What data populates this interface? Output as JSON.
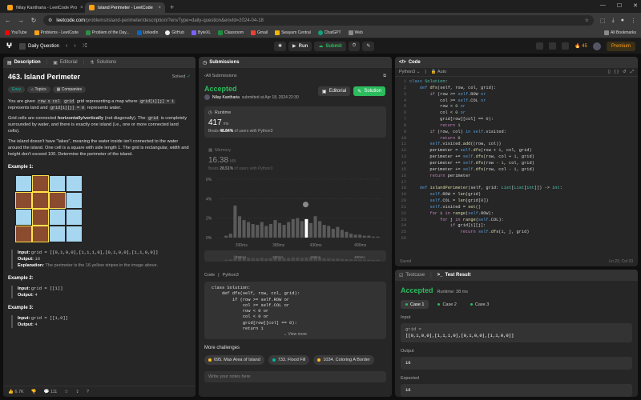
{
  "browser": {
    "tabs": [
      {
        "title": "Nilay Kantharia - LeetCode Pro",
        "active": false
      },
      {
        "title": "Island Perimeter - LeetCode",
        "active": true
      }
    ],
    "url_host": "leetcode.com",
    "url_path": "/problems/island-perimeter/description/?envType=daily-question&envId=2024-04-18",
    "bookmarks": [
      "YouTube",
      "Problems - LeetCode",
      "Problem of the Day...",
      "LinkedIn",
      "GitHub",
      "ByteXL",
      "Classroom",
      "Gmail",
      "Swayam Central",
      "ChatGPT",
      "Web"
    ],
    "all_bookmarks": "All Bookmarks"
  },
  "header": {
    "daily": "Daily Question",
    "run": "Run",
    "submit": "Submit",
    "streak": "45",
    "premium": "Premium"
  },
  "desc": {
    "tabs": [
      "Description",
      "Editorial",
      "Solutions"
    ],
    "title": "463. Island Perimeter",
    "solved": "Solved",
    "tags": [
      "Easy",
      "Topics",
      "Companies"
    ],
    "p1_a": "You are given",
    "p1_code1": "row x col",
    "p1_b": "grid representing a map where",
    "p1_code2": "grid[i][j] = 1",
    "p1_c": "represents land and",
    "p1_code3": "grid[i][j] = 0",
    "p1_d": "represents water.",
    "p2_a": "Grid cells are connected",
    "p2_b": "horizontally/vertically",
    "p2_c": "(not diagonally). The",
    "p2_code": "grid",
    "p2_d": "is completely surrounded by water, and there is exactly one island (i.e., one or more connected land cells).",
    "p3": "The island doesn't have \"lakes\", meaning the water inside isn't connected to the water around the island. One cell is a square with side length 1. The grid is rectangular, width and height don't exceed 100. Determine the perimeter of the island.",
    "examples": [
      {
        "h": "Example 1:",
        "input": "grid = [[0,1,0,0],[1,1,1,0],[0,1,0,0],[1,1,0,0]]",
        "output": "16",
        "expl": "The perimeter is the 16 yellow stripes in the image above."
      },
      {
        "h": "Example 2:",
        "input": "grid = [[1]]",
        "output": "4"
      },
      {
        "h": "Example 3:",
        "input": "grid = [[1,0]]",
        "output": "4"
      }
    ],
    "lbl_input": "Input:",
    "lbl_output": "Output:",
    "lbl_expl": "Explanation:",
    "grid": [
      [
        0,
        1,
        0,
        0
      ],
      [
        1,
        1,
        1,
        0
      ],
      [
        0,
        1,
        0,
        0
      ],
      [
        1,
        1,
        0,
        0
      ]
    ],
    "likes": "6.7K",
    "comments": "111"
  },
  "subs": {
    "tab": "Submissions",
    "back": "All Submissions",
    "status": "Accepted",
    "user": "Nilay Kantharia",
    "submitted": "submitted at Apr 18, 2024 22:30",
    "editorial": "Editorial",
    "solution": "Solution",
    "runtime_label": "Runtime",
    "runtime_val": "417",
    "runtime_unit": "ms",
    "runtime_beats_a": "Beats",
    "runtime_beats_pct": "48.84%",
    "runtime_beats_b": "of users with Python3",
    "memory_label": "Memory",
    "memory_val": "16.38",
    "memory_unit": "MB",
    "memory_beats_a": "Beats",
    "memory_beats_pct": "28.51%",
    "memory_beats_b": "of users with Python3",
    "code_label": "Code",
    "code_lang": "Python3",
    "code": [
      "class Solution:",
      "    def dfs(self, row, col, grid):",
      "        if (row >= self.ROW or",
      "            col >= self.COL or",
      "            row < 0 or",
      "            col < 0 or",
      "            grid[row][col] == 0):",
      "            return 1"
    ],
    "view_more": "View more",
    "more_challenges": "More challenges",
    "challenges": [
      "695. Max Area of Island",
      "733. Flood Fill",
      "1034. Coloring A Border"
    ],
    "notes_placeholder": "Write your notes here"
  },
  "chart_data": {
    "type": "bar",
    "title": "",
    "ylabel": "",
    "xlabel": "",
    "yticks": [
      "6%",
      "4%",
      "2%",
      "0%"
    ],
    "ylim": [
      0,
      6
    ],
    "xticks": [
      "330ms",
      "380ms",
      "430ms",
      "490ms"
    ],
    "xrange": [
      300,
      520
    ],
    "highlight_x": 417,
    "x": [
      310,
      316,
      322,
      328,
      334,
      340,
      346,
      352,
      358,
      364,
      370,
      376,
      382,
      388,
      394,
      400,
      406,
      412,
      418,
      424,
      430,
      436,
      442,
      448,
      454,
      460,
      466,
      472,
      478,
      484,
      490,
      496,
      502,
      508,
      514
    ],
    "values": [
      0.2,
      0.4,
      3.3,
      2.2,
      1.8,
      1.6,
      1.4,
      1.3,
      1.6,
      1.2,
      1.4,
      1.8,
      1.5,
      1.3,
      1.6,
      1.9,
      2.0,
      1.7,
      1.9,
      1.5,
      2.2,
      1.7,
      1.3,
      1.2,
      0.9,
      1.1,
      0.8,
      0.6,
      0.4,
      0.3,
      0.3,
      0.2,
      0.2,
      0.1,
      0.1
    ]
  },
  "code": {
    "tab": "Code",
    "lang": "Python3",
    "auto": "Auto",
    "saved": "Saved",
    "cursor": "Ln 23, Col 33"
  },
  "test": {
    "tabs": [
      "Testcase",
      "Test Result"
    ],
    "status": "Accepted",
    "runtime": "Runtime: 38 ms",
    "cases": [
      "Case 1",
      "Case 2",
      "Case 3"
    ],
    "input_label": "Input",
    "var": "grid =",
    "input_value": "[[0,1,0,0],[1,1,1,0],[0,1,0,0],[1,1,0,0]]",
    "output_label": "Output",
    "output_value": "16",
    "expected_label": "Expected",
    "expected_value": "16"
  }
}
